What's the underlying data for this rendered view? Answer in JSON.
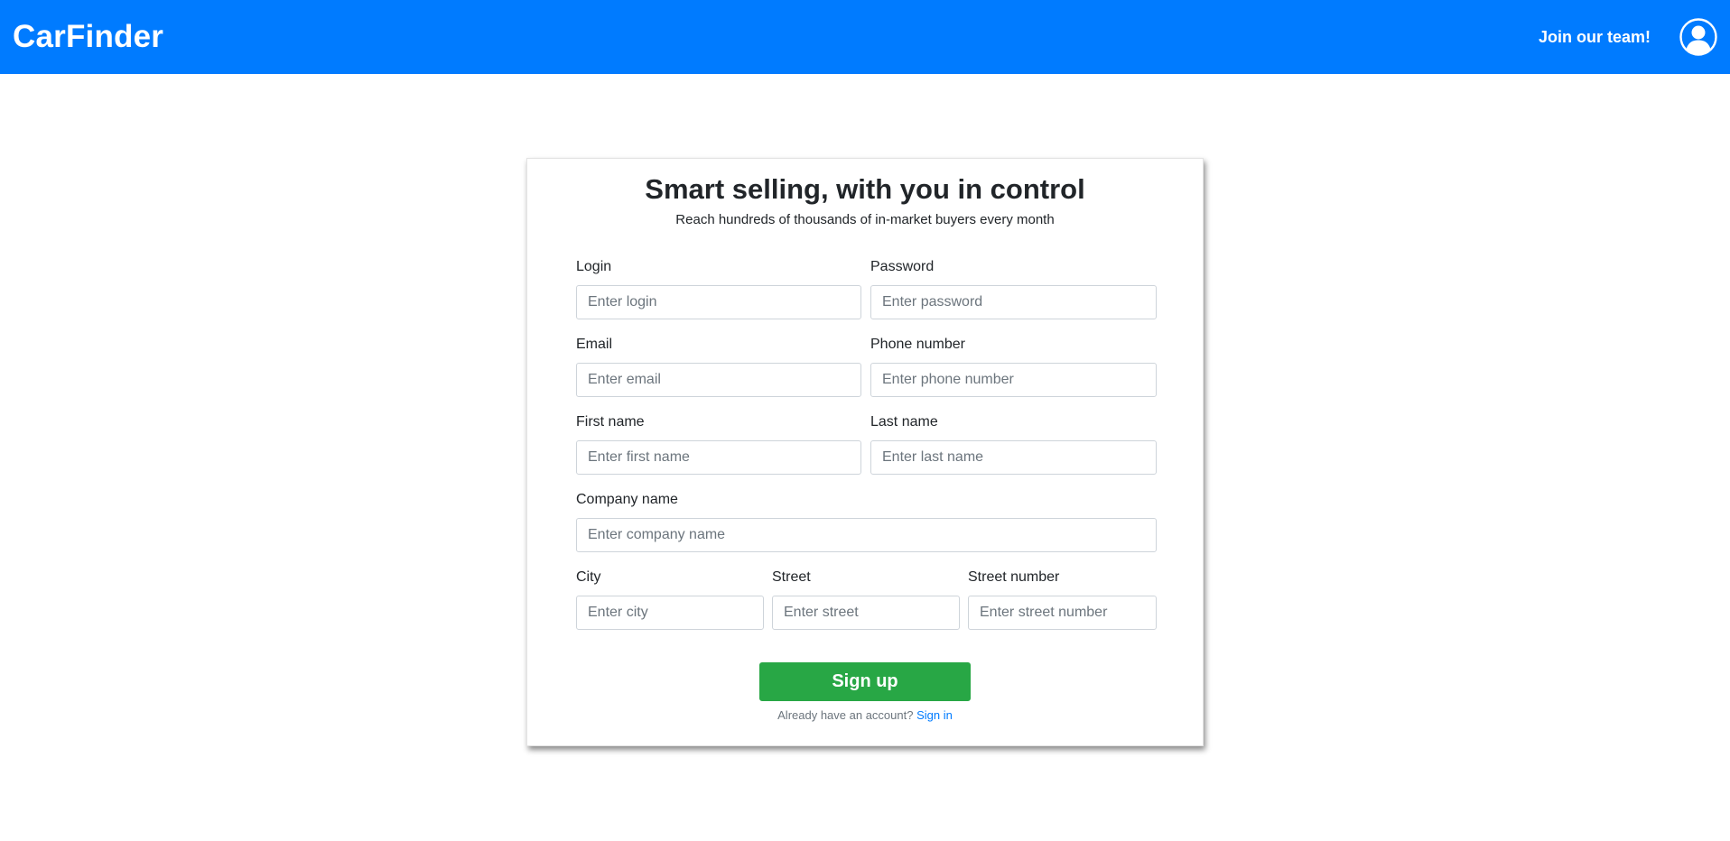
{
  "navbar": {
    "brand": "CarFinder",
    "join_link": "Join our team!",
    "avatar_icon": "user-circle-icon",
    "bg_color": "#007bff"
  },
  "form": {
    "title": "Smart selling, with you in control",
    "subtitle": "Reach hundreds of thousands of in-market buyers every month",
    "fields": {
      "login": {
        "label": "Login",
        "placeholder": "Enter login",
        "value": ""
      },
      "password": {
        "label": "Password",
        "placeholder": "Enter password",
        "value": ""
      },
      "email": {
        "label": "Email",
        "placeholder": "Enter email",
        "value": ""
      },
      "phone": {
        "label": "Phone number",
        "placeholder": "Enter phone number",
        "value": ""
      },
      "first_name": {
        "label": "First name",
        "placeholder": "Enter first name",
        "value": ""
      },
      "last_name": {
        "label": "Last name",
        "placeholder": "Enter last name",
        "value": ""
      },
      "company": {
        "label": "Company name",
        "placeholder": "Enter company name",
        "value": ""
      },
      "city": {
        "label": "City",
        "placeholder": "Enter city",
        "value": ""
      },
      "street": {
        "label": "Street",
        "placeholder": "Enter street",
        "value": ""
      },
      "street_number": {
        "label": "Street number",
        "placeholder": "Enter street number",
        "value": ""
      }
    },
    "signup_button": "Sign up",
    "signup_color": "#28a745",
    "signin_prompt": "Already have an account?",
    "signin_link": "Sign in"
  }
}
